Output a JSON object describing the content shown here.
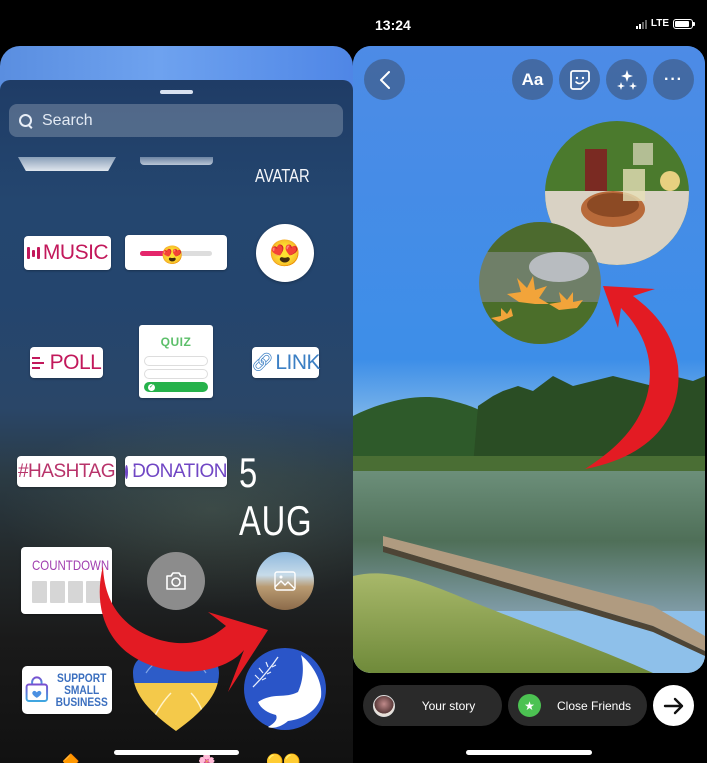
{
  "left_panel": {
    "search": {
      "placeholder": "Search",
      "value": ""
    },
    "stickers": {
      "avatar": "AVATAR",
      "music": "MUSIC",
      "emoji_slider": {
        "emoji": "😍",
        "value": 0.45
      },
      "reaction": "😍",
      "poll": "POLL",
      "quiz": "QUIZ",
      "link": "LINK",
      "hashtag": "#HASHTAG",
      "donation": "DONATION",
      "date": "5 AUG",
      "countdown": "COUNTDOWN",
      "support": [
        "SUPPORT",
        "SMALL",
        "BUSINESS"
      ],
      "ukraine_heart": "ukraine-heart-sticker",
      "peace_dove": "peace-dove-sticker"
    },
    "annotation_color": "#e31b23"
  },
  "right_panel": {
    "status": {
      "time": "13:24",
      "network": "LTE",
      "battery": 0.85
    },
    "toolbar": {
      "back": "back-icon",
      "text": "Aa",
      "sticker": "sticker-icon",
      "effects": "sparkles-icon",
      "more": "···"
    },
    "share": {
      "your_story": "Your story",
      "close_friends": "Close Friends",
      "next": "→"
    },
    "annotation_color": "#e31b23"
  }
}
